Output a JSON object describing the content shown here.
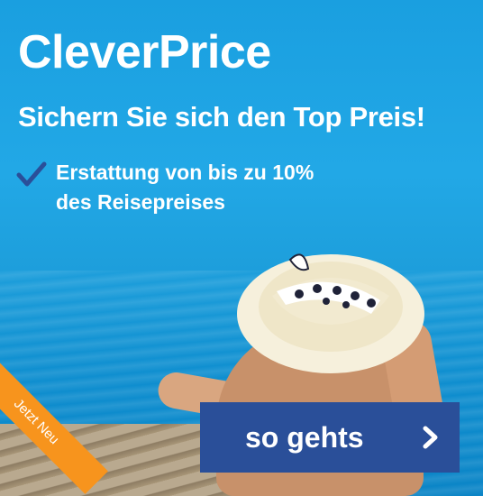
{
  "banner": {
    "title": "CleverPrice",
    "subtitle": "Sichern Sie sich den Top Preis!",
    "benefit_line1": "Erstattung von bis zu 10%",
    "benefit_line2": "des Reisepreises",
    "corner_badge": "Jetzt Neu",
    "cta_label": "so gehts"
  },
  "colors": {
    "sky": "#1a9fe0",
    "cta_background": "#2a4f99",
    "check_mark": "#2a4f99",
    "corner_badge": "#f7941d",
    "text": "#ffffff"
  },
  "icons": [
    "check-mark-icon",
    "chevron-right-icon"
  ]
}
